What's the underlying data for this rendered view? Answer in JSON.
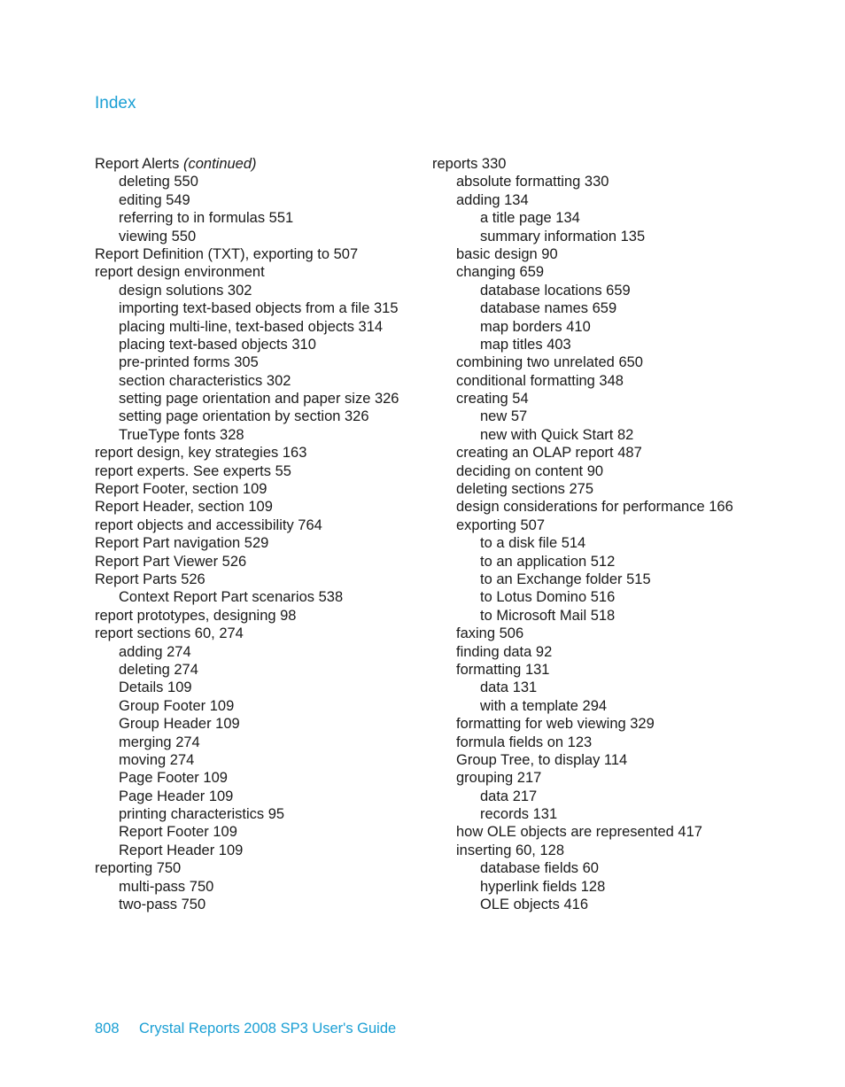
{
  "header": {
    "title": "Index"
  },
  "left_column": [
    {
      "level": 0,
      "text": "Report Alerts",
      "note": "(continued)"
    },
    {
      "level": 1,
      "text": "deleting 550"
    },
    {
      "level": 1,
      "text": "editing 549"
    },
    {
      "level": 1,
      "text": "referring to in formulas 551"
    },
    {
      "level": 1,
      "text": "viewing 550"
    },
    {
      "level": 0,
      "text": "Report Definition (TXT), exporting to 507"
    },
    {
      "level": 0,
      "text": "report design environment"
    },
    {
      "level": 1,
      "text": "design solutions 302"
    },
    {
      "level": 1,
      "text": "importing text-based objects from a file 315"
    },
    {
      "level": 1,
      "text": "placing multi-line, text-based objects 314"
    },
    {
      "level": 1,
      "text": "placing text-based objects 310"
    },
    {
      "level": 1,
      "text": "pre-printed forms 305"
    },
    {
      "level": 1,
      "text": "section characteristics 302"
    },
    {
      "level": 1,
      "text": "setting page orientation and paper size 326"
    },
    {
      "level": 1,
      "text": "setting page orientation by section 326"
    },
    {
      "level": 1,
      "text": "TrueType fonts 328"
    },
    {
      "level": 0,
      "text": "report design, key strategies 163"
    },
    {
      "level": 0,
      "text": "report experts. See experts 55"
    },
    {
      "level": 0,
      "text": "Report Footer, section 109"
    },
    {
      "level": 0,
      "text": "Report Header, section 109"
    },
    {
      "level": 0,
      "text": "report objects and accessibility 764"
    },
    {
      "level": 0,
      "text": "Report Part navigation 529"
    },
    {
      "level": 0,
      "text": "Report Part Viewer 526"
    },
    {
      "level": 0,
      "text": "Report Parts 526"
    },
    {
      "level": 1,
      "text": "Context Report Part scenarios 538"
    },
    {
      "level": 0,
      "text": "report prototypes, designing 98"
    },
    {
      "level": 0,
      "text": "report sections 60, 274"
    },
    {
      "level": 1,
      "text": "adding 274"
    },
    {
      "level": 1,
      "text": "deleting 274"
    },
    {
      "level": 1,
      "text": "Details 109"
    },
    {
      "level": 1,
      "text": "Group Footer 109"
    },
    {
      "level": 1,
      "text": "Group Header 109"
    },
    {
      "level": 1,
      "text": "merging 274"
    },
    {
      "level": 1,
      "text": "moving 274"
    },
    {
      "level": 1,
      "text": "Page Footer 109"
    },
    {
      "level": 1,
      "text": "Page Header 109"
    },
    {
      "level": 1,
      "text": "printing characteristics 95"
    },
    {
      "level": 1,
      "text": "Report Footer 109"
    },
    {
      "level": 1,
      "text": "Report Header 109"
    },
    {
      "level": 0,
      "text": "reporting 750"
    },
    {
      "level": 1,
      "text": "multi-pass 750"
    },
    {
      "level": 1,
      "text": "two-pass 750"
    }
  ],
  "right_column": [
    {
      "level": 0,
      "text": "reports 330"
    },
    {
      "level": 1,
      "text": "absolute formatting 330"
    },
    {
      "level": 1,
      "text": "adding 134"
    },
    {
      "level": 2,
      "text": "a title page 134"
    },
    {
      "level": 2,
      "text": "summary information 135"
    },
    {
      "level": 1,
      "text": "basic design 90"
    },
    {
      "level": 1,
      "text": "changing 659"
    },
    {
      "level": 2,
      "text": "database locations 659"
    },
    {
      "level": 2,
      "text": "database names 659"
    },
    {
      "level": 2,
      "text": "map borders 410"
    },
    {
      "level": 2,
      "text": "map titles 403"
    },
    {
      "level": 1,
      "text": "combining two unrelated 650"
    },
    {
      "level": 1,
      "text": "conditional formatting 348"
    },
    {
      "level": 1,
      "text": "creating 54"
    },
    {
      "level": 2,
      "text": "new 57"
    },
    {
      "level": 2,
      "text": "new with Quick Start 82"
    },
    {
      "level": 1,
      "text": "creating an OLAP report 487"
    },
    {
      "level": 1,
      "text": "deciding on content 90"
    },
    {
      "level": 1,
      "text": "deleting sections 275"
    },
    {
      "level": 1,
      "text": "design considerations for performance 166"
    },
    {
      "level": 1,
      "text": "exporting 507"
    },
    {
      "level": 2,
      "text": "to a disk file 514"
    },
    {
      "level": 2,
      "text": "to an application 512"
    },
    {
      "level": 2,
      "text": "to an Exchange folder 515"
    },
    {
      "level": 2,
      "text": "to Lotus Domino 516"
    },
    {
      "level": 2,
      "text": "to Microsoft Mail 518"
    },
    {
      "level": 1,
      "text": "faxing 506"
    },
    {
      "level": 1,
      "text": "finding data 92"
    },
    {
      "level": 1,
      "text": "formatting 131"
    },
    {
      "level": 2,
      "text": "data 131"
    },
    {
      "level": 2,
      "text": "with a template 294"
    },
    {
      "level": 1,
      "text": "formatting for web viewing 329"
    },
    {
      "level": 1,
      "text": "formula fields on 123"
    },
    {
      "level": 1,
      "text": "Group Tree, to display 114"
    },
    {
      "level": 1,
      "text": "grouping 217"
    },
    {
      "level": 2,
      "text": "data 217"
    },
    {
      "level": 2,
      "text": "records 131"
    },
    {
      "level": 1,
      "text": "how OLE objects are represented 417"
    },
    {
      "level": 1,
      "text": "inserting 60, 128"
    },
    {
      "level": 2,
      "text": "database fields 60"
    },
    {
      "level": 2,
      "text": "hyperlink fields 128"
    },
    {
      "level": 2,
      "text": "OLE objects 416"
    }
  ],
  "footer": {
    "page_number": "808",
    "book_title": "Crystal Reports 2008 SP3 User's Guide"
  },
  "colors": {
    "accent": "#1a9fd4",
    "text": "#1a1a1a"
  }
}
